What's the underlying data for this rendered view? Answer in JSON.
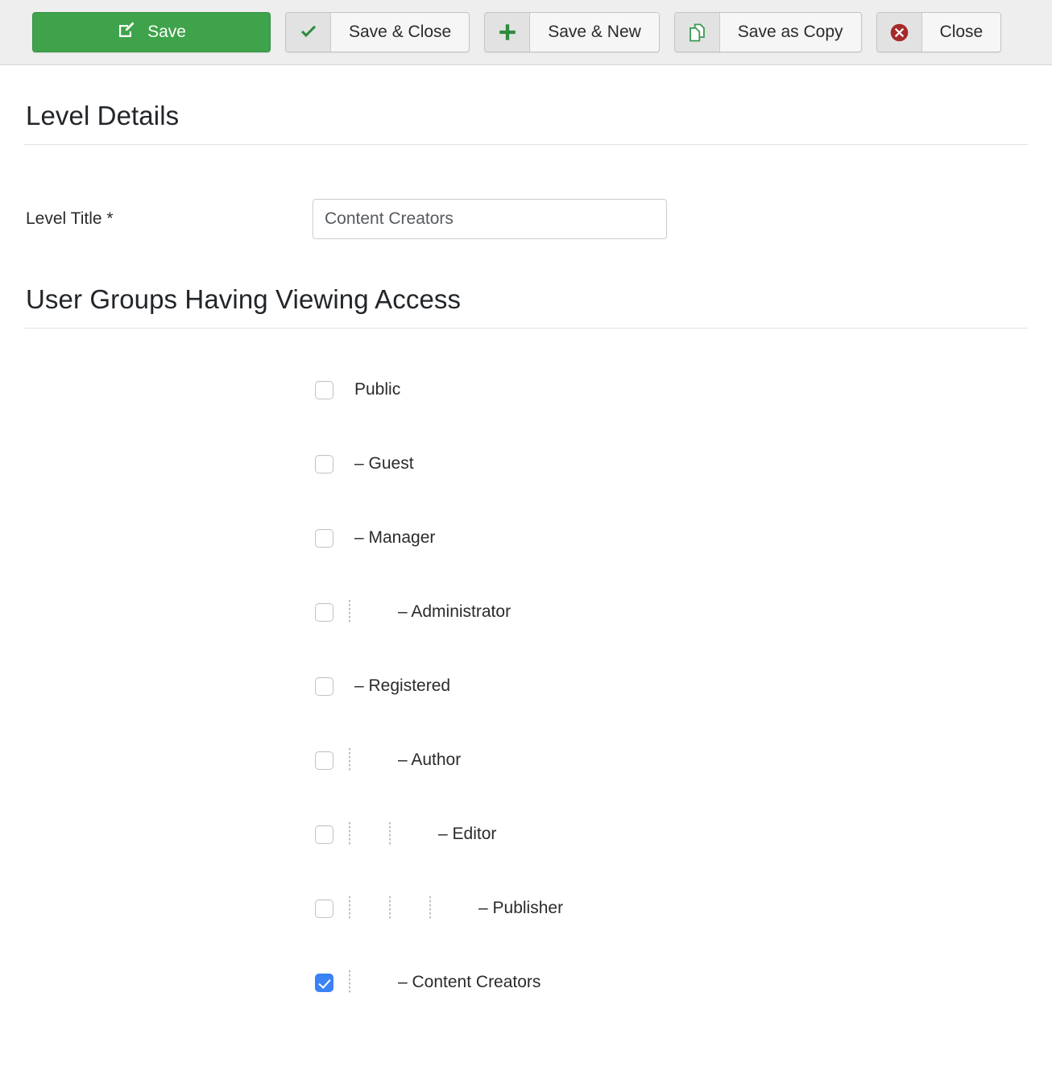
{
  "toolbar": {
    "buttons": [
      {
        "id": "save",
        "label": "Save",
        "icon": "edit-pencil-square-icon",
        "style": "primary"
      },
      {
        "id": "save-close",
        "label": "Save & Close",
        "icon": "check-icon",
        "style": "default"
      },
      {
        "id": "save-new",
        "label": "Save & New",
        "icon": "plus-icon",
        "style": "default"
      },
      {
        "id": "save-copy",
        "label": "Save as Copy",
        "icon": "copy-documents-icon",
        "style": "default"
      },
      {
        "id": "close",
        "label": "Close",
        "icon": "close-circle-icon",
        "style": "default"
      }
    ]
  },
  "colors": {
    "primary_green": "#3ea34a",
    "icon_green": "#2e8b3d",
    "close_red": "#a52a2a",
    "checkbox_blue": "#3b82f6",
    "toolbar_bg": "#eeeeee"
  },
  "details": {
    "heading": "Level Details",
    "level_title_label": "Level Title *",
    "level_title_value": "Content Creators",
    "level_title_placeholder": ""
  },
  "access": {
    "heading": "User Groups Having Viewing Access",
    "groups": [
      {
        "label": "Public",
        "depth": 0,
        "checked": false
      },
      {
        "label": "– Guest",
        "depth": 0,
        "checked": false
      },
      {
        "label": "– Manager",
        "depth": 0,
        "checked": false
      },
      {
        "label": "– Administrator",
        "depth": 1,
        "checked": false
      },
      {
        "label": "– Registered",
        "depth": 0,
        "checked": false
      },
      {
        "label": "– Author",
        "depth": 1,
        "checked": false
      },
      {
        "label": "– Editor",
        "depth": 2,
        "checked": false
      },
      {
        "label": "– Publisher",
        "depth": 3,
        "checked": false
      },
      {
        "label": "– Content Creators",
        "depth": 1,
        "checked": true
      }
    ]
  }
}
